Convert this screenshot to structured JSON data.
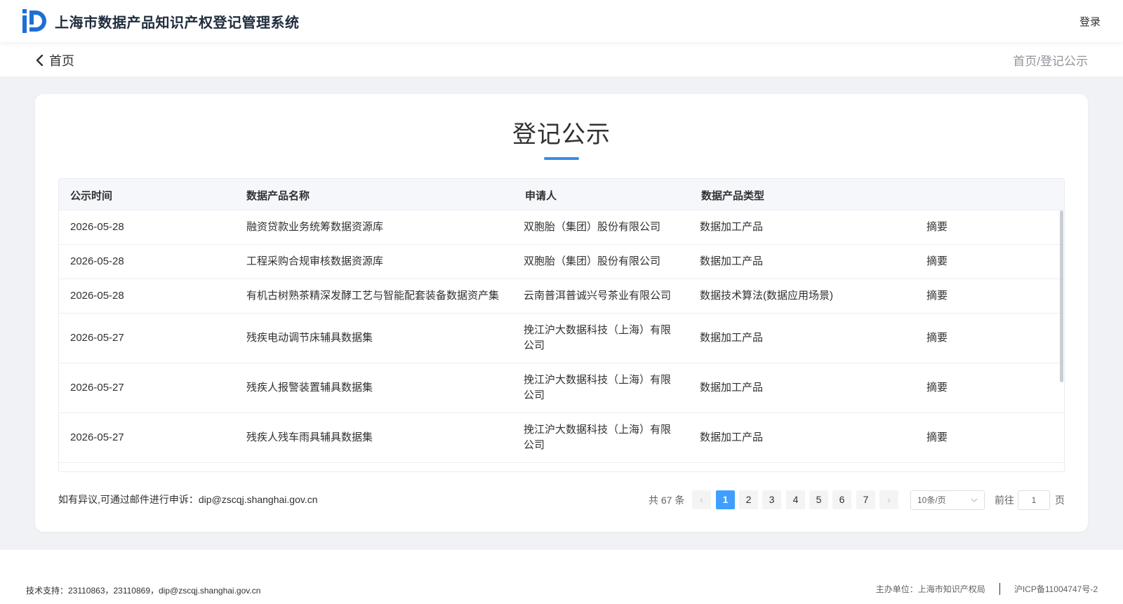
{
  "header": {
    "app_title": "上海市数据产品知识产权登记管理系统",
    "login_label": "登录"
  },
  "subbar": {
    "back_label": "首页",
    "breadcrumb": "首页/登记公示"
  },
  "main": {
    "title": "登记公示",
    "columns": [
      "公示时间",
      "数据产品名称",
      "申请人",
      "数据产品类型"
    ],
    "rows": [
      {
        "date": "2026-05-28",
        "name": "融资贷款业务统筹数据资源库",
        "applicant": "双胞胎（集团）股份有限公司",
        "type": "数据加工产品",
        "action": "摘要"
      },
      {
        "date": "2026-05-28",
        "name": "工程采购合规审核数据资源库",
        "applicant": "双胞胎（集团）股份有限公司",
        "type": "数据加工产品",
        "action": "摘要"
      },
      {
        "date": "2026-05-28",
        "name": "有机古树熟茶精深发酵工艺与智能配套装备数据资产集",
        "applicant": "云南普洱普诚兴号茶业有限公司",
        "type": "数据技术算法(数据应用场景)",
        "action": "摘要"
      },
      {
        "date": "2026-05-27",
        "name": "残疾电动调节床辅具数据集",
        "applicant": "挽江沪大数据科技（上海）有限公司",
        "type": "数据加工产品",
        "action": "摘要"
      },
      {
        "date": "2026-05-27",
        "name": "残疾人报警装置辅具数据集",
        "applicant": "挽江沪大数据科技（上海）有限公司",
        "type": "数据加工产品",
        "action": "摘要"
      },
      {
        "date": "2026-05-27",
        "name": "残疾人残车雨具辅具数据集",
        "applicant": "挽江沪大数据科技（上海）有限公司",
        "type": "数据加工产品",
        "action": "摘要"
      }
    ],
    "complaint": "如有异议,可通过邮件进行申诉：dip@zscqj.shanghai.gov.cn"
  },
  "pagination": {
    "total": "共 67 条",
    "pages": [
      "1",
      "2",
      "3",
      "4",
      "5",
      "6",
      "7"
    ],
    "current": "1",
    "prev": "‹",
    "next": "›",
    "page_size": "10条/页",
    "goto_label": "前往",
    "goto_value": "1",
    "page_unit": "页"
  },
  "footer": {
    "support": "技术支持：23110863，23110869，dip@zscqj.shanghai.gov.cn",
    "sponsor": "主办单位：上海市知识产权局",
    "icp": "沪ICP备11004747号-2"
  },
  "colors": {
    "accent": "#409eff",
    "brand": "#1d6fd6",
    "background": "#f0f2f5"
  },
  "icons": [
    "logo-icon",
    "chevron-left-icon",
    "chevron-down-icon"
  ]
}
